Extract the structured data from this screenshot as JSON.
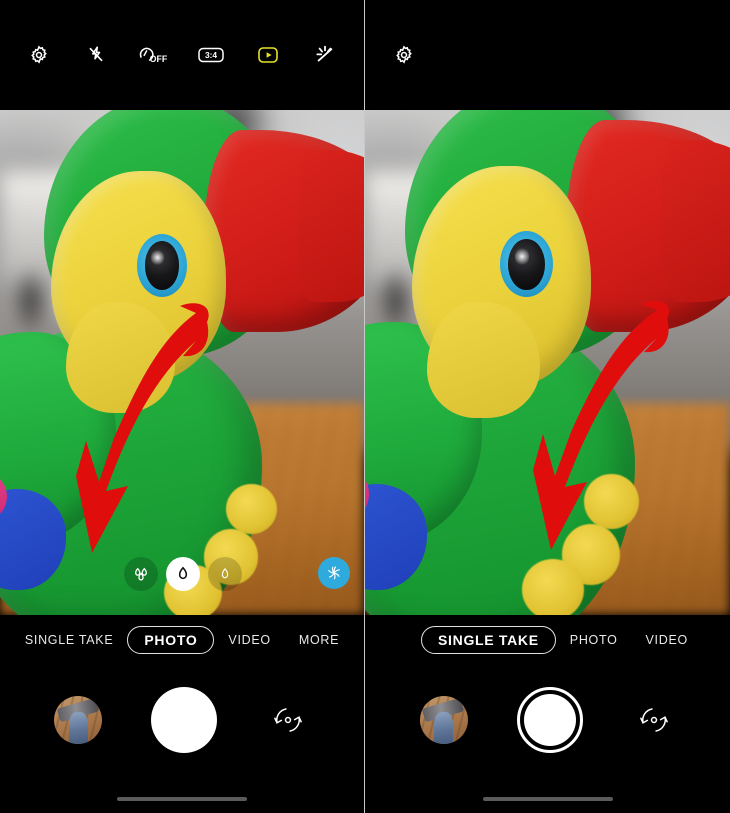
{
  "app": {
    "name": "Camera",
    "background": "#000000"
  },
  "colors": {
    "accent_yellow": "#e8e22a",
    "arrow_red": "#e00d0d",
    "filter_blue": "#2eaadc",
    "divider": "#c9c9c9",
    "nav_pill": "#5b5b5b",
    "text": "#e9e9e9"
  },
  "panels": [
    {
      "id": "left",
      "label": "photo-mode-panel",
      "topbar": {
        "icons": [
          {
            "name": "settings-gear-icon",
            "label": "Settings",
            "state": "default"
          },
          {
            "name": "flash-off-icon",
            "label": "Flash off",
            "state": "off"
          },
          {
            "name": "timer-off-icon",
            "label": "Timer",
            "state": "OFF",
            "text": "OFF"
          },
          {
            "name": "aspect-ratio-icon",
            "label": "Aspect ratio",
            "text": "3:4"
          },
          {
            "name": "motion-photo-icon",
            "label": "Motion photo",
            "state": "on"
          },
          {
            "name": "beauty-effects-icon",
            "label": "Effects",
            "state": "default"
          }
        ]
      },
      "viewfinder": {
        "subject": "plush toucan toy",
        "lenses": [
          {
            "name": "lens-ultrawide",
            "glyph": "triple-leaf",
            "selected": false
          },
          {
            "name": "lens-wide",
            "glyph": "single-leaf",
            "selected": true
          },
          {
            "name": "lens-tele",
            "glyph": "outline-leaf",
            "selected": false
          }
        ],
        "filter_button": {
          "name": "filters-button",
          "label": "Filters"
        },
        "annotation": {
          "name": "red-arrow-annotation",
          "points_to": "SINGLE TAKE"
        }
      },
      "modes": [
        {
          "label": "SINGLE TAKE",
          "selected": false
        },
        {
          "label": "PHOTO",
          "selected": true
        },
        {
          "label": "VIDEO",
          "selected": false
        },
        {
          "label": "MORE",
          "selected": false
        }
      ],
      "controls": {
        "gallery": {
          "name": "gallery-thumbnail",
          "label": "Gallery"
        },
        "shutter": {
          "name": "shutter-button",
          "label": "Shutter",
          "style": "solid"
        },
        "flip": {
          "name": "switch-camera-icon",
          "label": "Switch camera"
        }
      }
    },
    {
      "id": "right",
      "label": "single-take-mode-panel",
      "topbar": {
        "icons": [
          {
            "name": "settings-gear-icon",
            "label": "Settings",
            "state": "default"
          }
        ]
      },
      "viewfinder": {
        "subject": "plush toucan toy",
        "lenses": [],
        "annotation": {
          "name": "red-arrow-annotation",
          "points_to": "SINGLE TAKE"
        }
      },
      "modes": [
        {
          "label": "SINGLE TAKE",
          "selected": true
        },
        {
          "label": "PHOTO",
          "selected": false
        },
        {
          "label": "VIDEO",
          "selected": false
        }
      ],
      "controls": {
        "gallery": {
          "name": "gallery-thumbnail",
          "label": "Gallery"
        },
        "shutter": {
          "name": "shutter-button",
          "label": "Start Single Take",
          "style": "ring"
        },
        "flip": {
          "name": "switch-camera-icon",
          "label": "Switch camera"
        }
      }
    }
  ]
}
